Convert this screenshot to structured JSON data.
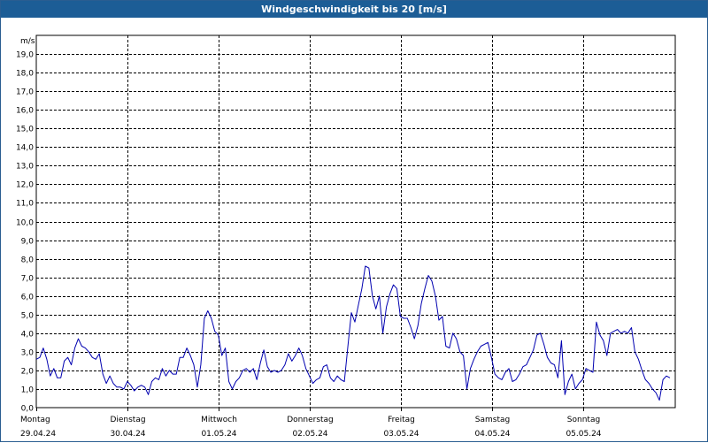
{
  "window": {
    "title": "Windgeschwindigkeit bis 20 [m/s]"
  },
  "chart_data": {
    "type": "line",
    "title": "Windgeschwindigkeit bis 20 [m/s]",
    "ylabel": "m/s",
    "ylim": [
      0,
      20
    ],
    "y_ticks": [
      "0,0",
      "1,0",
      "2,0",
      "3,0",
      "4,0",
      "5,0",
      "6,0",
      "7,0",
      "8,0",
      "9,0",
      "10,0",
      "11,0",
      "12,0",
      "13,0",
      "14,0",
      "15,0",
      "16,0",
      "17,0",
      "18,0",
      "19,0"
    ],
    "days": [
      {
        "weekday": "Montag",
        "date": "29.04.24"
      },
      {
        "weekday": "Dienstag",
        "date": "30.04.24"
      },
      {
        "weekday": "Mittwoch",
        "date": "01.05.24"
      },
      {
        "weekday": "Donnerstag",
        "date": "02.05.24"
      },
      {
        "weekday": "Freitag",
        "date": "03.05.24"
      },
      {
        "weekday": "Samstag",
        "date": "04.05.24"
      },
      {
        "weekday": "Sonntag",
        "date": "05.05.24"
      }
    ],
    "grid": true,
    "line_color": "#0000b0",
    "series": [
      {
        "values": [
          2.6,
          2.7,
          3.2,
          2.6,
          1.7,
          2.1,
          1.6,
          1.6,
          2.5,
          2.7,
          2.3,
          3.2,
          3.7,
          3.3,
          3.2,
          3.0,
          2.7,
          2.6,
          2.9,
          1.8,
          1.3,
          1.7,
          1.3,
          1.1,
          1.1,
          1.0,
          1.4,
          1.2,
          0.9,
          1.1,
          1.2,
          1.1,
          0.7,
          1.4,
          1.6,
          1.5,
          2.1,
          1.7,
          2.0,
          1.8,
          1.8,
          2.7,
          2.7,
          3.2,
          2.8,
          2.3,
          1.1,
          2.3,
          4.8,
          5.2,
          4.8,
          4.1,
          3.9,
          2.8,
          3.2,
          1.4,
          1.0,
          1.4,
          1.6,
          2.0,
          2.1,
          1.9,
          2.1,
          1.5,
          2.4,
          3.1,
          2.2,
          1.9,
          2.0,
          1.9,
          2.0,
          2.3,
          2.9,
          2.5,
          2.8,
          3.2,
          2.8,
          2.1,
          1.7,
          1.3,
          1.5,
          1.6,
          2.2,
          2.3,
          1.6,
          1.4,
          1.7,
          1.5,
          1.4,
          3.3,
          5.1,
          4.6,
          5.5,
          6.4,
          7.6,
          7.5,
          6.0,
          5.3,
          6.0,
          4.0,
          5.4,
          6.1,
          6.6,
          6.4,
          4.9,
          4.8,
          4.8,
          4.3,
          3.7,
          4.4,
          5.6,
          6.4,
          7.1,
          6.8,
          6.0,
          4.7,
          4.9,
          3.3,
          3.2,
          4.0,
          3.7,
          3.0,
          2.8,
          1.0,
          2.1,
          2.6,
          3.0,
          3.3,
          3.4,
          3.5,
          2.7,
          1.8,
          1.6,
          1.5,
          1.9,
          2.1,
          1.4,
          1.5,
          1.8,
          2.2,
          2.3,
          2.7,
          3.1,
          3.9,
          4.0,
          3.4,
          2.7,
          2.4,
          2.3,
          1.6,
          3.6,
          0.7,
          1.4,
          1.8,
          1.0,
          1.3,
          1.5,
          2.1,
          2.0,
          1.9,
          4.6,
          3.9,
          3.6,
          2.8,
          4.0,
          4.1,
          4.2,
          4.0,
          4.1,
          4.0,
          4.3,
          3.0,
          2.6,
          2.0,
          1.5,
          1.3,
          1.0,
          0.8,
          0.4,
          1.5,
          1.7,
          1.6
        ]
      }
    ]
  }
}
